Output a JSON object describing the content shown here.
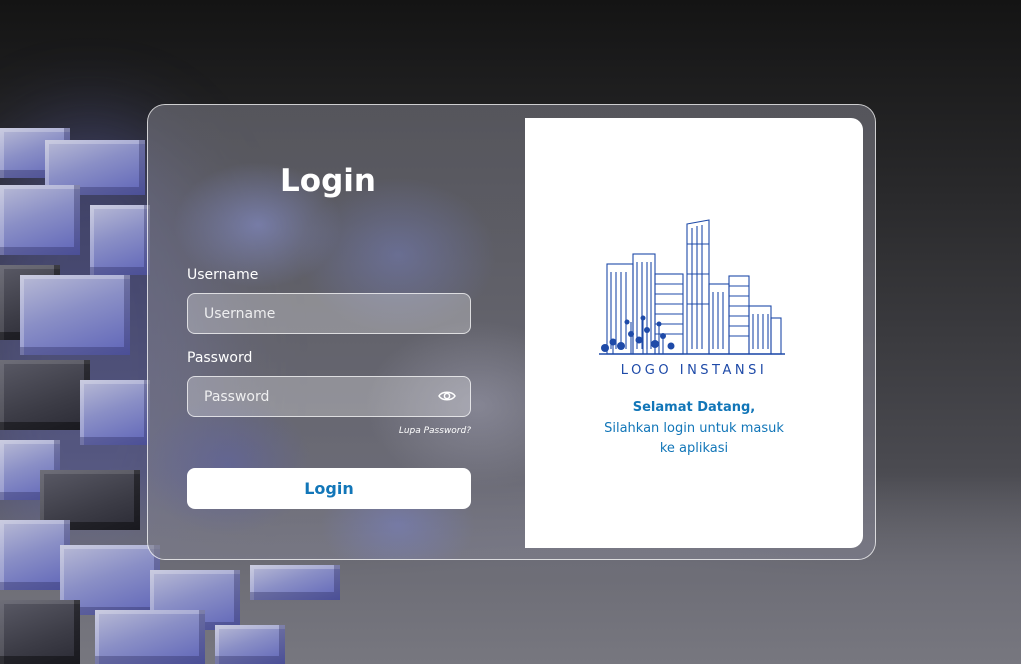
{
  "login": {
    "title": "Login",
    "username_label": "Username",
    "username_placeholder": "Username",
    "username_value": "",
    "password_label": "Password",
    "password_placeholder": "Password",
    "password_value": "",
    "password_toggle_icon": "eye-icon",
    "forgot_password": "Lupa Password?",
    "submit_label": "Login"
  },
  "brand": {
    "logo_icon": "city-buildings-icon",
    "logo_text": "LOGO INSTANSI",
    "welcome": "Selamat Datang,",
    "subtitle": "Silahkan login untuk masuk ke aplikasi"
  },
  "colors": {
    "accent": "#1276b8",
    "logo": "#1e4aa8",
    "panel": "#ffffff"
  }
}
